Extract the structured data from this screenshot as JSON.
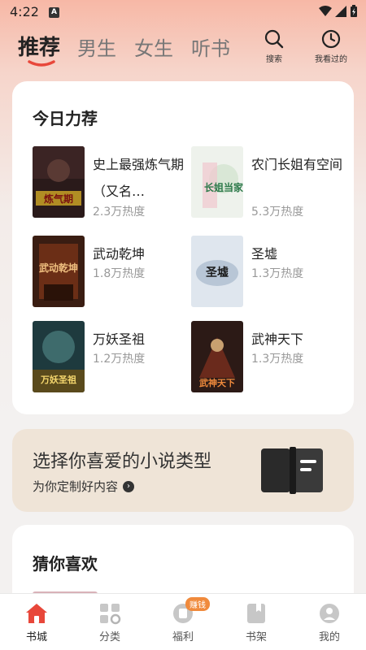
{
  "status_bar": {
    "time": "4:22",
    "notif_letter": "A"
  },
  "header": {
    "tabs": [
      {
        "label": "推荐",
        "active": true
      },
      {
        "label": "男生"
      },
      {
        "label": "女生"
      },
      {
        "label": "听书"
      }
    ],
    "search_label": "搜索",
    "history_label": "我看过的"
  },
  "recommend": {
    "title": "今日力荐",
    "books": [
      {
        "title": "史上最强炼气期（又名…",
        "heat": "2.3万热度",
        "cover_text": "炼气期"
      },
      {
        "title": "农门长姐有空间",
        "heat": "5.3万热度",
        "cover_text": "长姐当家"
      },
      {
        "title": "武动乾坤",
        "heat": "1.8万热度",
        "cover_text": "武动乾坤"
      },
      {
        "title": "圣墟",
        "heat": "1.3万热度",
        "cover_text": "圣墟"
      },
      {
        "title": "万妖圣祖",
        "heat": "1.2万热度",
        "cover_text": "万妖圣祖"
      },
      {
        "title": "武神天下",
        "heat": "1.3万热度",
        "cover_text": "武神天下"
      }
    ]
  },
  "promo": {
    "title": "选择你喜爱的小说类型",
    "subtitle": "为你定制好内容"
  },
  "guess": {
    "title": "猜你喜欢"
  },
  "bottom_nav": {
    "items": [
      {
        "label": "书城",
        "active": true
      },
      {
        "label": "分类"
      },
      {
        "label": "福利",
        "badge": "赚钱"
      },
      {
        "label": "书架"
      },
      {
        "label": "我的"
      }
    ]
  },
  "colors": {
    "accent": "#e8473a",
    "badge": "#f08a3c"
  }
}
